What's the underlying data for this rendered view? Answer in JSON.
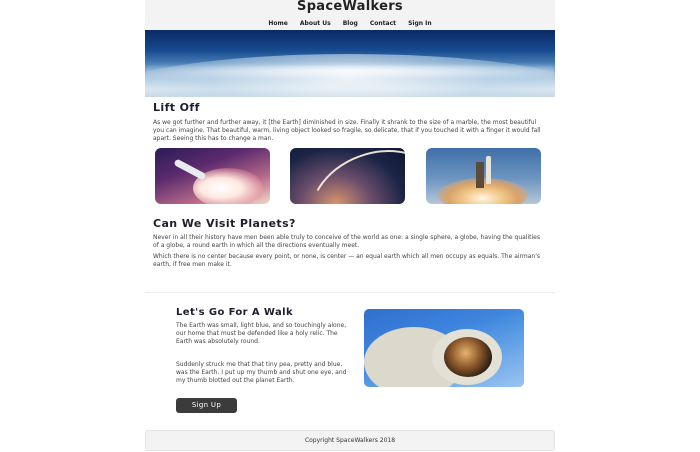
{
  "site": {
    "brand": "SpaceWalkers"
  },
  "nav": {
    "items": [
      "Home",
      "About Us",
      "Blog",
      "Contact",
      "Sign In"
    ]
  },
  "section1": {
    "title": "Lift Off",
    "text": "As we got further and further away, it [the Earth] diminished in size. Finally it shrank to the size of a marble, the most beautiful you can imagine. That beautiful, warm, living object looked so fragile, so delicate, that if you touched it with a finger it would fall apart. Seeing this has to change a man."
  },
  "section2": {
    "title": "Can We Visit Planets?",
    "para1": "Never in all their history have men been able truly to conceive of the world as one: a single sphere, a globe, having the qualities of a globe, a round earth in which all the directions eventually meet.",
    "para2": "Which there is no center because every point, or none, is center — an equal earth which all men occupy as equals. The airman's earth, if free men make it."
  },
  "section3": {
    "title": "Let's Go For A Walk",
    "para1": "The Earth was small, light blue, and so touchingly alone, our home that must be defended like a holy relic. The Earth was absolutely round.",
    "para2": "Suddenly struck me that that tiny pea, pretty and blue, was the Earth. I put up my thumb and shut one eye, and my thumb blotted out the planet Earth.",
    "button": "Sign Up"
  },
  "footer": {
    "text": "Copyright SpaceWalkers 2018"
  }
}
